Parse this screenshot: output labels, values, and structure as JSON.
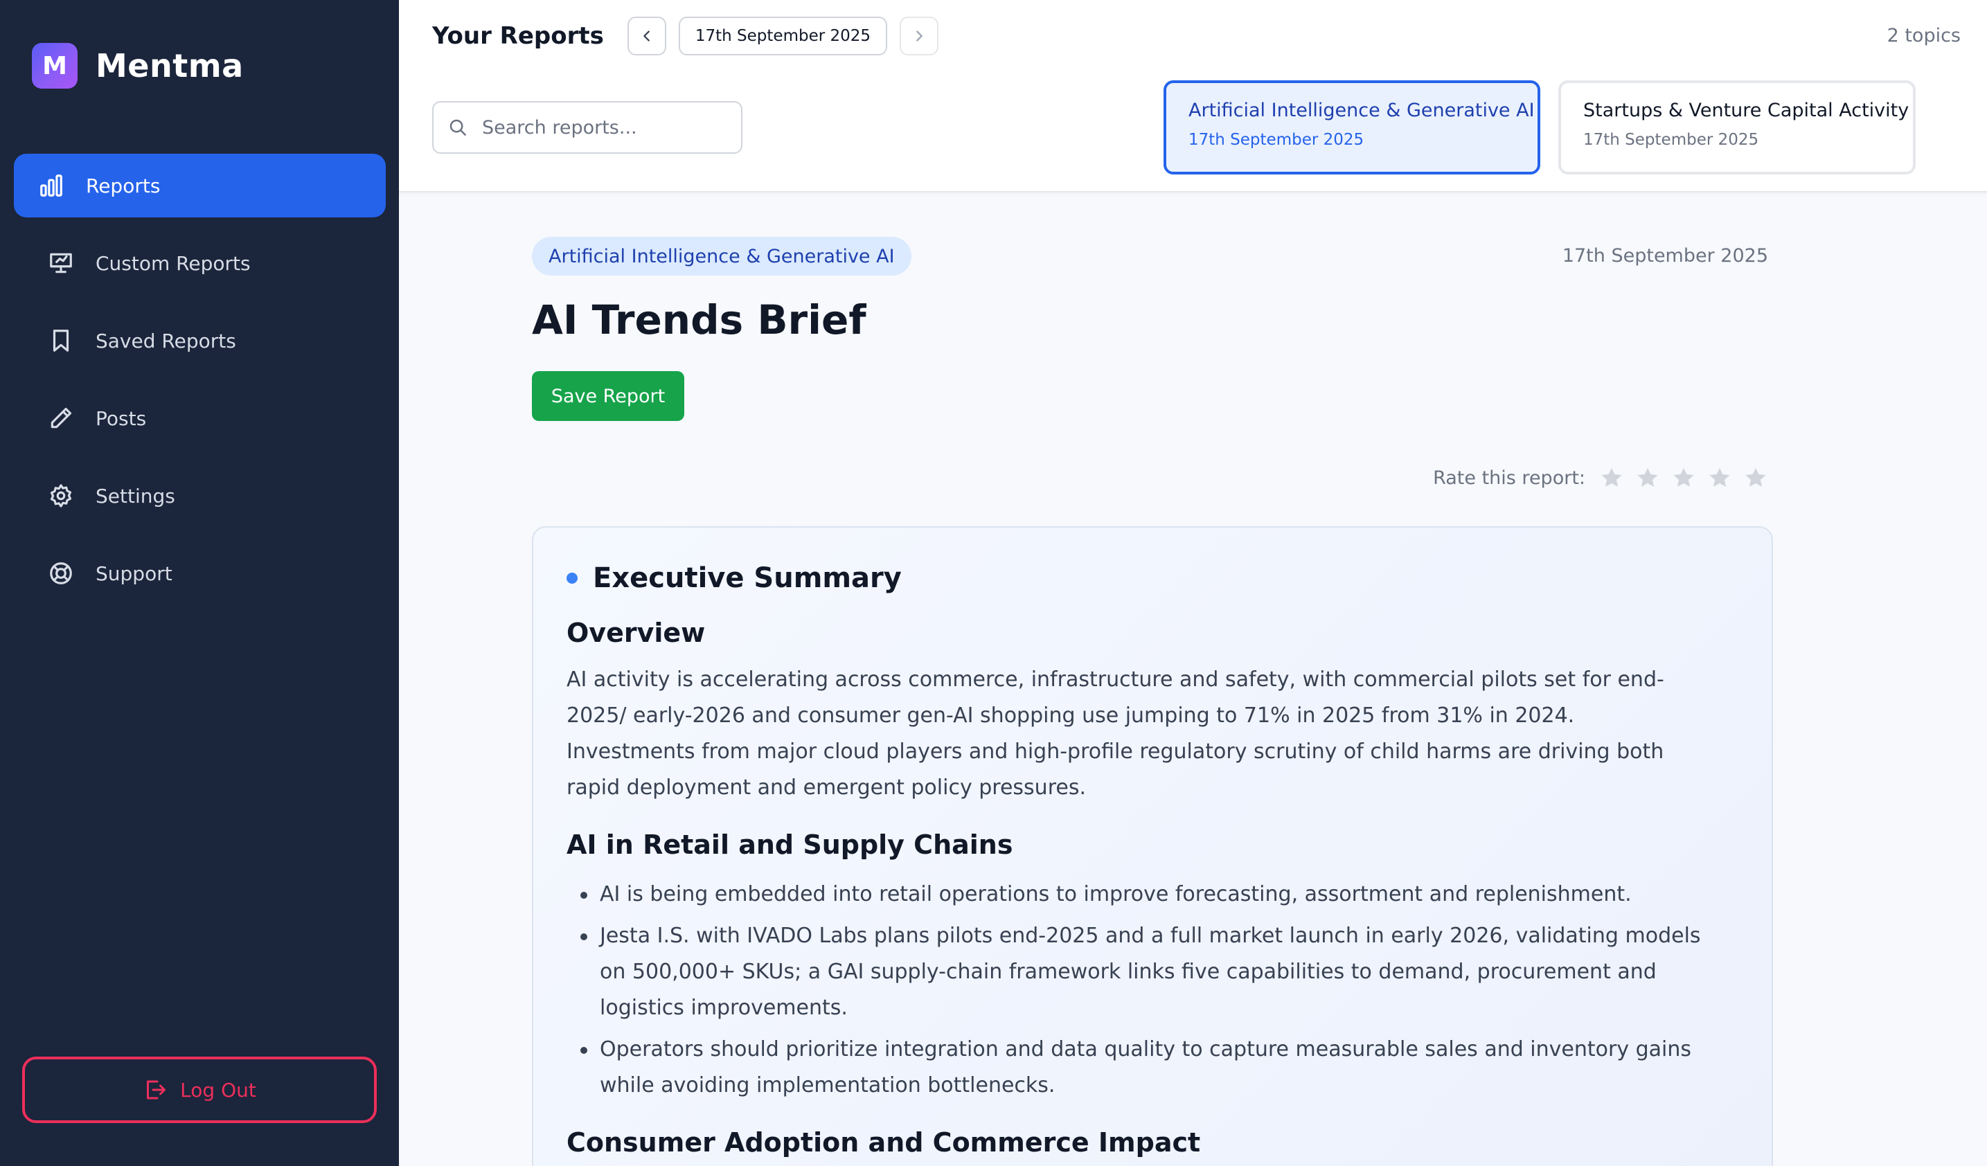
{
  "app": {
    "name": "Mentma",
    "logo_letter": "M",
    "logo_colors": [
      "#5b5cf6",
      "#a855f7"
    ]
  },
  "sidebar": {
    "items": [
      {
        "label": "Reports",
        "icon": "bar-chart-icon",
        "active": true
      },
      {
        "label": "Custom Reports",
        "icon": "presentation-icon",
        "active": false
      },
      {
        "label": "Saved Reports",
        "icon": "bookmark-icon",
        "active": false
      },
      {
        "label": "Posts",
        "icon": "pencil-icon",
        "active": false
      },
      {
        "label": "Settings",
        "icon": "gear-icon",
        "active": false
      },
      {
        "label": "Support",
        "icon": "lifebuoy-icon",
        "active": false
      }
    ],
    "logout_label": "Log Out",
    "active_color": "#2563eb",
    "logout_color": "#ec2f5b"
  },
  "header": {
    "title": "Your Reports",
    "current_date": "17th September 2025",
    "topics_count": "2 topics",
    "search_placeholder": "Search reports...",
    "topics": [
      {
        "title": "Artificial Intelligence & Generative AI",
        "date": "17th September 2025",
        "selected": true
      },
      {
        "title": "Startups & Venture Capital Activity",
        "date": "17th September 2025",
        "selected": false
      }
    ]
  },
  "report": {
    "topic_badge": "Artificial Intelligence & Generative AI",
    "date": "17th September 2025",
    "title": "AI Trends Brief",
    "save_label": "Save Report",
    "save_color": "#16a34a",
    "rate_label": "Rate this report:",
    "rating": 0,
    "rating_max": 5,
    "section_title": "Executive Summary",
    "overview_heading": "Overview",
    "overview_text": "AI activity is accelerating across commerce, infrastructure and safety, with commercial pilots set for end-2025/ early-2026 and consumer gen-AI shopping use jumping to 71% in 2025 from 31% in 2024. Investments from major cloud players and high-profile regulatory scrutiny of child harms are driving both rapid deployment and emergent policy pressures.",
    "retail_heading": "AI in Retail and Supply Chains",
    "retail_bullets": [
      "AI is being embedded into retail operations to improve forecasting, assortment and replenishment.",
      "Jesta I.S. with IVADO Labs plans pilots end-2025 and a full market launch in early 2026, validating models on 500,000+ SKUs; a GAI supply-chain framework links five capabilities to demand, procurement and logistics improvements.",
      "Operators should prioritize integration and data quality to capture measurable sales and inventory gains while avoiding implementation bottlenecks."
    ],
    "next_heading": "Consumer Adoption and Commerce Impact"
  }
}
